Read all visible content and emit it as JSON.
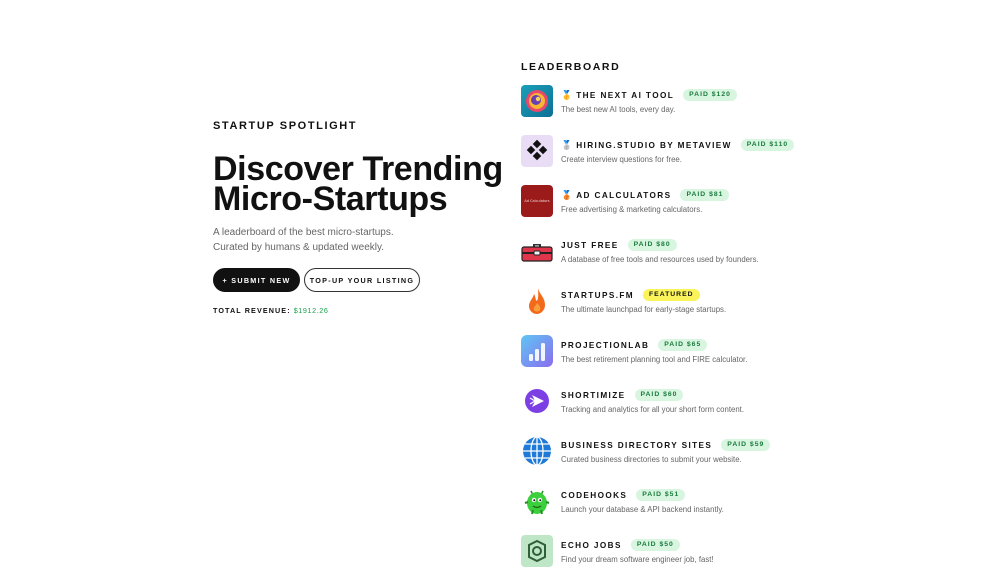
{
  "hero": {
    "eyebrow": "STARTUP SPOTLIGHT",
    "headline_line1": "Discover Trending",
    "headline_line2": "Micro-Startups",
    "sub_line1": "A leaderboard of the best micro-startups.",
    "sub_line2": "Curated by humans & updated weekly.",
    "submit_label": "+ SUBMIT NEW",
    "topup_label": "TOP-UP YOUR LISTING",
    "revenue_label": "TOTAL REVENUE:",
    "revenue_value": "$1912.26"
  },
  "leaderboard": {
    "title": "LEADERBOARD",
    "items": [
      {
        "medal": "🥇",
        "name": "THE NEXT AI TOOL",
        "badge": "PAID $120",
        "badge_type": "paid",
        "desc": "The best new AI tools, every day.",
        "icon": "next-ai-tool-logo"
      },
      {
        "medal": "🥈",
        "name": "HIRING.STUDIO BY METAVIEW",
        "badge": "PAID $110",
        "badge_type": "paid",
        "desc": "Create interview questions for free.",
        "icon": "hiring-studio-logo"
      },
      {
        "medal": "🥉",
        "name": "AD CALCULATORS",
        "badge": "PAID $81",
        "badge_type": "paid",
        "desc": "Free advertising & marketing calculators.",
        "icon": "ad-calculators-logo",
        "logo_text": "Ad Calculators"
      },
      {
        "medal": "",
        "name": "JUST FREE",
        "badge": "PAID $80",
        "badge_type": "paid",
        "desc": "A database of free tools and resources used by founders.",
        "icon": "toolbox-icon"
      },
      {
        "medal": "",
        "name": "STARTUPS.FM",
        "badge": "FEATURED",
        "badge_type": "featured",
        "desc": "The ultimate launchpad for early-stage startups.",
        "icon": "flame-icon"
      },
      {
        "medal": "",
        "name": "PROJECTIONLAB",
        "badge": "PAID $65",
        "badge_type": "paid",
        "desc": "The best retirement planning tool and FIRE calculator.",
        "icon": "bar-chart-icon"
      },
      {
        "medal": "",
        "name": "SHORTIMIZE",
        "badge": "PAID $60",
        "badge_type": "paid",
        "desc": "Tracking and analytics for all your short form content.",
        "icon": "play-icon"
      },
      {
        "medal": "",
        "name": "BUSINESS DIRECTORY SITES",
        "badge": "PAID $59",
        "badge_type": "paid",
        "desc": "Curated business directories to submit your website.",
        "icon": "globe-icon"
      },
      {
        "medal": "",
        "name": "CODEHOOKS",
        "badge": "PAID $51",
        "badge_type": "paid",
        "desc": "Launch your database & API backend instantly.",
        "icon": "monster-icon"
      },
      {
        "medal": "",
        "name": "ECHO JOBS",
        "badge": "PAID $50",
        "badge_type": "paid",
        "desc": "Find your dream software engineer job, fast!",
        "icon": "echo-jobs-logo"
      }
    ]
  },
  "colors": {
    "accent_green": "#16a34a",
    "paid_badge_bg": "#d8f5e0",
    "featured_badge_bg": "#faf35a"
  }
}
